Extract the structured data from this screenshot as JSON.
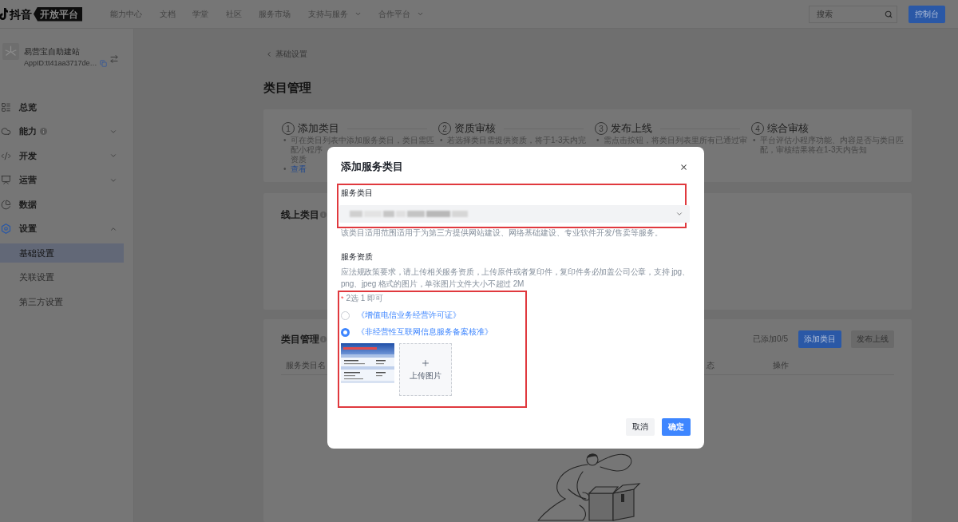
{
  "top_nav": {
    "brand": "抖音",
    "tag": "开放平台",
    "items": [
      {
        "label": "能力中心",
        "dropdown": false
      },
      {
        "label": "文档",
        "dropdown": false
      },
      {
        "label": "学堂",
        "dropdown": false
      },
      {
        "label": "社区",
        "dropdown": false
      },
      {
        "label": "服务市场",
        "dropdown": false
      },
      {
        "label": "支持与服务",
        "dropdown": true
      },
      {
        "label": "合作平台",
        "dropdown": true
      }
    ],
    "search": {
      "placeholder": "搜索"
    },
    "console_button": "控制台"
  },
  "sidebar": {
    "app": {
      "name": "易营宝自助建站",
      "app_id": "AppID:tt41aa3717de…"
    },
    "menu": [
      {
        "kind": "link",
        "label": "总览",
        "hint": false
      },
      {
        "kind": "group",
        "label": "能力",
        "hint": true,
        "expanded": false
      },
      {
        "kind": "group",
        "label": "开发",
        "hint": false,
        "expanded": false
      },
      {
        "kind": "group",
        "label": "运营",
        "hint": false,
        "expanded": false
      },
      {
        "kind": "link",
        "label": "数据",
        "hint": false
      },
      {
        "kind": "group",
        "label": "设置",
        "hint": false,
        "expanded": true,
        "children": [
          {
            "label": "基础设置",
            "selected": true
          },
          {
            "label": "关联设置",
            "selected": false
          },
          {
            "label": "第三方设置",
            "selected": false
          }
        ]
      }
    ]
  },
  "breadcrumb": "基础设置",
  "page_title": "类目管理",
  "steps": [
    {
      "number": "1",
      "title": "添加类目",
      "lines": [
        {
          "bullet": "•",
          "text": "可在类目列表中添加服务类目，类目需匹",
          "link": false
        },
        {
          "text": "配小程序",
          "link": false
        },
        {
          "text": "资质",
          "link": false
        },
        {
          "bullet": "•",
          "text": "查看",
          "link": true
        }
      ]
    },
    {
      "number": "2",
      "title": "资质审核",
      "lines": [
        {
          "bullet": "•",
          "text": "若选择类目需提供资质，将于1-3天内完",
          "link": false
        }
      ]
    },
    {
      "number": "3",
      "title": "发布上线",
      "lines": [
        {
          "bullet": "•",
          "text": "需点击按钮，将类目列表里所有已通过审",
          "link": false
        }
      ]
    },
    {
      "number": "4",
      "title": "综合审核",
      "lines": [
        {
          "bullet": "•",
          "text": "平台评估小程序功能、内容是否与类目匹",
          "link": false
        },
        {
          "text": "配，审核结果将在1-3天内告知",
          "link": false
        }
      ]
    }
  ],
  "online_categories": {
    "title": "线上类目"
  },
  "category_management": {
    "title": "类目管理",
    "count": "已添加0/5",
    "buttons": [
      {
        "label": "添加类目",
        "disabled": false
      },
      {
        "label": "发布上线",
        "disabled": true
      }
    ],
    "columns": [
      "服务类目名",
      "态",
      "操作"
    ]
  },
  "modal": {
    "title": "添加服务类目",
    "category": {
      "label": "服务类目",
      "highlighted": true,
      "redacted": true,
      "hint": "该类目适用范围适用于为第三方提供网站建设、网络基础建设、专业软件开发/售卖等服务。"
    },
    "qualification": {
      "label": "服务资质",
      "description": "应法规政策要求，请上传相关服务资质，上传原件或者复印件，复印件务必加盖公司公章，支持 jpg、png、jpeg 格式的图片，单张图片文件大小不超过 2M",
      "highlighted": true,
      "requirement": {
        "mark": "*",
        "text": "2选 1 即可"
      },
      "options": [
        {
          "label": "《增值电信业务经营许可证》",
          "selected": false
        },
        {
          "label": "《非经营性互联网信息服务备案核准》",
          "selected": true
        }
      ],
      "uploaded_image": true,
      "upload_label": "上传图片"
    },
    "buttons": [
      {
        "label": "取消",
        "kind": "secondary"
      },
      {
        "label": "确定",
        "kind": "primary"
      }
    ]
  }
}
